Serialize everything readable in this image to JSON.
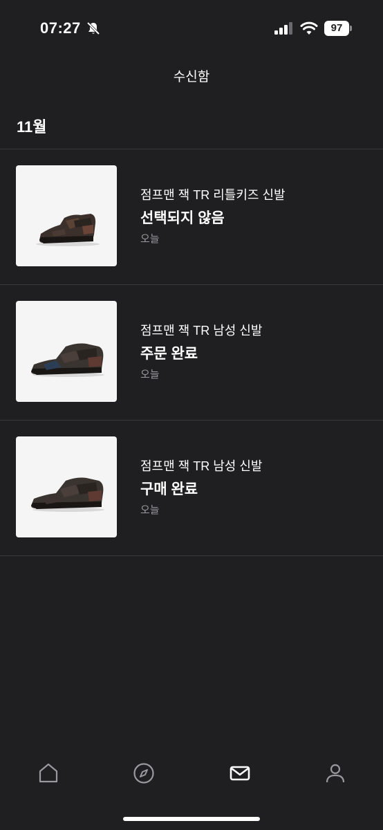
{
  "status_bar": {
    "time": "07:27",
    "battery": "97"
  },
  "header": {
    "title": "수신함"
  },
  "section": {
    "title": "11월"
  },
  "messages": [
    {
      "product": "점프맨 잭 TR 리틀키즈 신발",
      "status": "선택되지 않음",
      "date": "오늘",
      "thumb_icon": "sneaker-image"
    },
    {
      "product": "점프맨 잭 TR 남성 신발",
      "status": "주문 완료",
      "date": "오늘",
      "thumb_icon": "sneaker-image"
    },
    {
      "product": "점프맨 잭 TR 남성 신발",
      "status": "구매 완료",
      "date": "오늘",
      "thumb_icon": "sneaker-image"
    }
  ],
  "tab_bar": {
    "items": [
      {
        "icon": "home-icon",
        "active": false
      },
      {
        "icon": "compass-icon",
        "active": false
      },
      {
        "icon": "mail-icon",
        "active": true
      },
      {
        "icon": "profile-icon",
        "active": false
      }
    ]
  },
  "colors": {
    "background": "#1f1f21",
    "divider": "#3a3a3c",
    "secondary_text": "#9a9a9e",
    "thumb_bg": "#f5f5f5"
  }
}
